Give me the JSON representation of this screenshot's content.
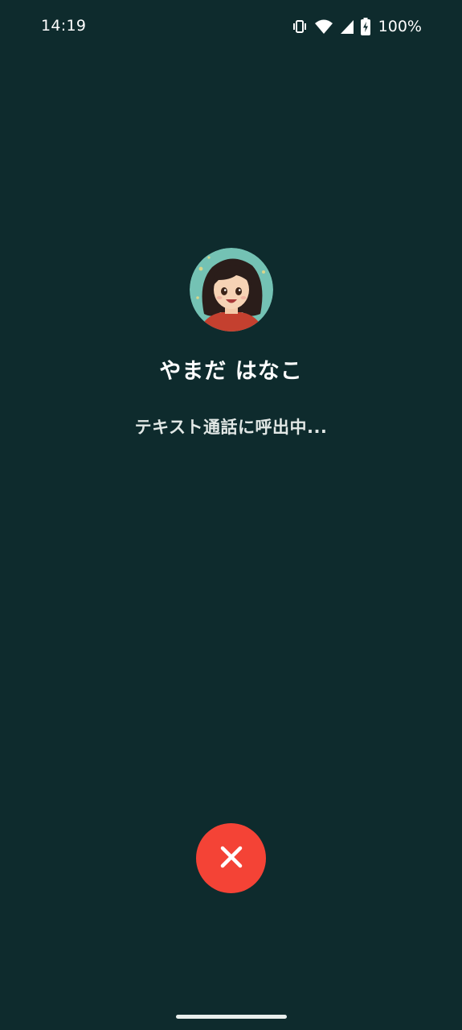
{
  "status_bar": {
    "time": "14:19",
    "icons": [
      "vibrate-icon",
      "wifi-icon",
      "cell-signal-icon",
      "battery-charging-icon"
    ],
    "battery_percent": "100%"
  },
  "caller": {
    "avatar": "avatar-illustration",
    "name": "やまだ はなこ",
    "status": "テキスト通話に呼出中..."
  },
  "end_call": {
    "icon": "close-icon",
    "color": "#f44336"
  },
  "theme": {
    "background": "#0e2b2d",
    "text": "#ffffff"
  }
}
